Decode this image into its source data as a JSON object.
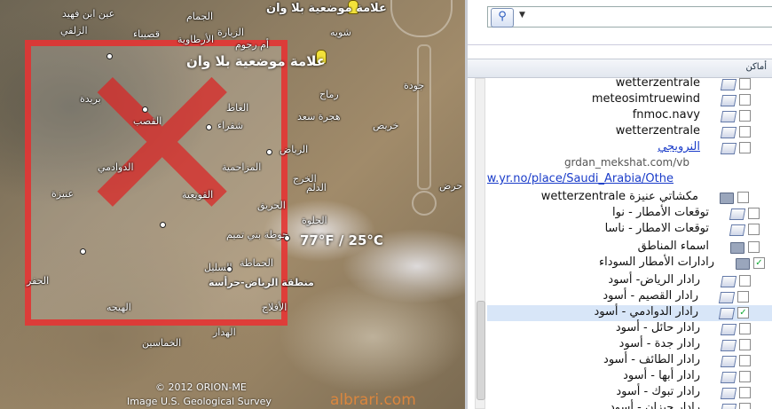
{
  "map": {
    "overlay_title": "علامة موضعية بلا وان",
    "top_label": "علامة موضعية بلا وان",
    "weather": "77°F / 25°C",
    "copyright": "© 2012 ORION-ME",
    "credit": "Image U.S. Geological Survey",
    "watermark": "albrari.com",
    "places": [
      {
        "name": "عين ابن فهيد"
      },
      {
        "name": "الجمام"
      },
      {
        "name": "شويه"
      },
      {
        "name": "قصيباء"
      },
      {
        "name": "الزيارة"
      },
      {
        "name": "الأرطاوية"
      },
      {
        "name": "الغاط"
      },
      {
        "name": "الزلفي"
      },
      {
        "name": "أم رجوم"
      },
      {
        "name": "الحفر"
      },
      {
        "name": "بريدة"
      },
      {
        "name": "عنيزة"
      },
      {
        "name": "شقراء"
      },
      {
        "name": "القصب"
      },
      {
        "name": "القويعية"
      },
      {
        "name": "الدوادمي"
      },
      {
        "name": "الرياض"
      },
      {
        "name": "الخرج"
      },
      {
        "name": "الحريق"
      },
      {
        "name": "حوطة بني تميم"
      },
      {
        "name": "الحلوة"
      },
      {
        "name": "السليل"
      },
      {
        "name": "الحماطة"
      },
      {
        "name": "هجرة سعد"
      },
      {
        "name": "خريص"
      },
      {
        "name": "الهيجه"
      },
      {
        "name": "الهدار"
      },
      {
        "name": "الأفلاج"
      },
      {
        "name": "الخماسين"
      },
      {
        "name": "حرض"
      },
      {
        "name": "الدلم"
      },
      {
        "name": "المزاحمية"
      },
      {
        "name": "رماح"
      },
      {
        "name": "جودة"
      },
      {
        "name": "منطقة الرياض-حرأسة"
      }
    ]
  },
  "sidebar": {
    "search_icon": "magnifier-icon",
    "search_value": "",
    "places_header": "أماكن",
    "items": [
      {
        "label": "wetterzentrale",
        "type": "doc",
        "checked": false
      },
      {
        "label": "meteosimtruewind",
        "type": "doc",
        "checked": false
      },
      {
        "label": "fnmoc.navy",
        "type": "doc",
        "checked": false
      },
      {
        "label": "wetterzentrale",
        "type": "doc",
        "checked": false
      },
      {
        "label": "النرويجي",
        "type": "doc-link",
        "checked": false
      },
      {
        "label": "grdan_mekshat.com/vb",
        "type": "text",
        "checked": false
      },
      {
        "label": "http://www.yr.no/place/Saudi_Arabia/Othe",
        "type": "link",
        "checked": false
      },
      {
        "label": "مكشاتي عنيزة wetterzentrale",
        "type": "folder",
        "checked": false
      },
      {
        "label": "توقعات الأمطار - نوا",
        "type": "doc",
        "checked": false
      },
      {
        "label": "توقعات الامطار - ناسا",
        "type": "doc",
        "checked": false
      },
      {
        "label": "اسماء المناطق",
        "type": "folder",
        "checked": false
      },
      {
        "label": "رادارات الأمطار السوداء",
        "type": "folder-open",
        "checked": true
      },
      {
        "label": "رادار الرياض- أسود",
        "type": "doc",
        "checked": false
      },
      {
        "label": "رادار القصيم - أسود",
        "type": "doc",
        "checked": false
      },
      {
        "label": "رادار الدوادمي - أسود",
        "type": "doc",
        "checked": true,
        "selected": true
      },
      {
        "label": "رادار حائل - أسود",
        "type": "doc",
        "checked": false
      },
      {
        "label": "رادار جدة - أسود",
        "type": "doc",
        "checked": false
      },
      {
        "label": "رادار الطائف - أسود",
        "type": "doc",
        "checked": false
      },
      {
        "label": "رادار أبها - أسود",
        "type": "doc",
        "checked": false
      },
      {
        "label": "رادار تبوك - أسود",
        "type": "doc",
        "checked": false
      },
      {
        "label": "رادار جيزان - أسود",
        "type": "doc",
        "checked": false
      }
    ]
  }
}
